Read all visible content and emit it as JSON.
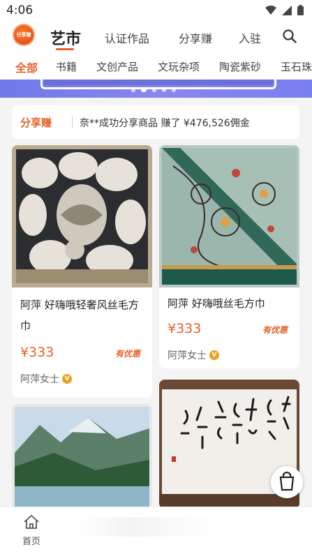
{
  "status": {
    "time": "4:06"
  },
  "header": {
    "logo_text": "分享赚",
    "active_tab": "艺市",
    "tabs": [
      "认证作品",
      "分享赚",
      "入驻"
    ]
  },
  "categories": [
    "全部",
    "书籍",
    "文创产品",
    "文玩杂项",
    "陶瓷紫砂",
    "玉石珠宝"
  ],
  "share_banner": {
    "tag": "分享赚",
    "message": "奈**成功分享商品 赚了 ¥476,526佣金"
  },
  "products": [
    {
      "title": "阿萍 好嗨哦轻奢风丝毛方巾",
      "price": "¥333",
      "promo": "有优惠",
      "seller": "阿萍女士",
      "badge": "V"
    },
    {
      "title": "阿萍 好嗨哦丝毛方巾",
      "price": "¥333",
      "promo": "有优惠",
      "seller": "阿萍女士",
      "badge": "V"
    }
  ],
  "tabbar": {
    "home_label": "首页"
  },
  "colors": {
    "accent": "#e8612a",
    "badge": "#e9a21f",
    "banner": "#7a7ff0"
  }
}
